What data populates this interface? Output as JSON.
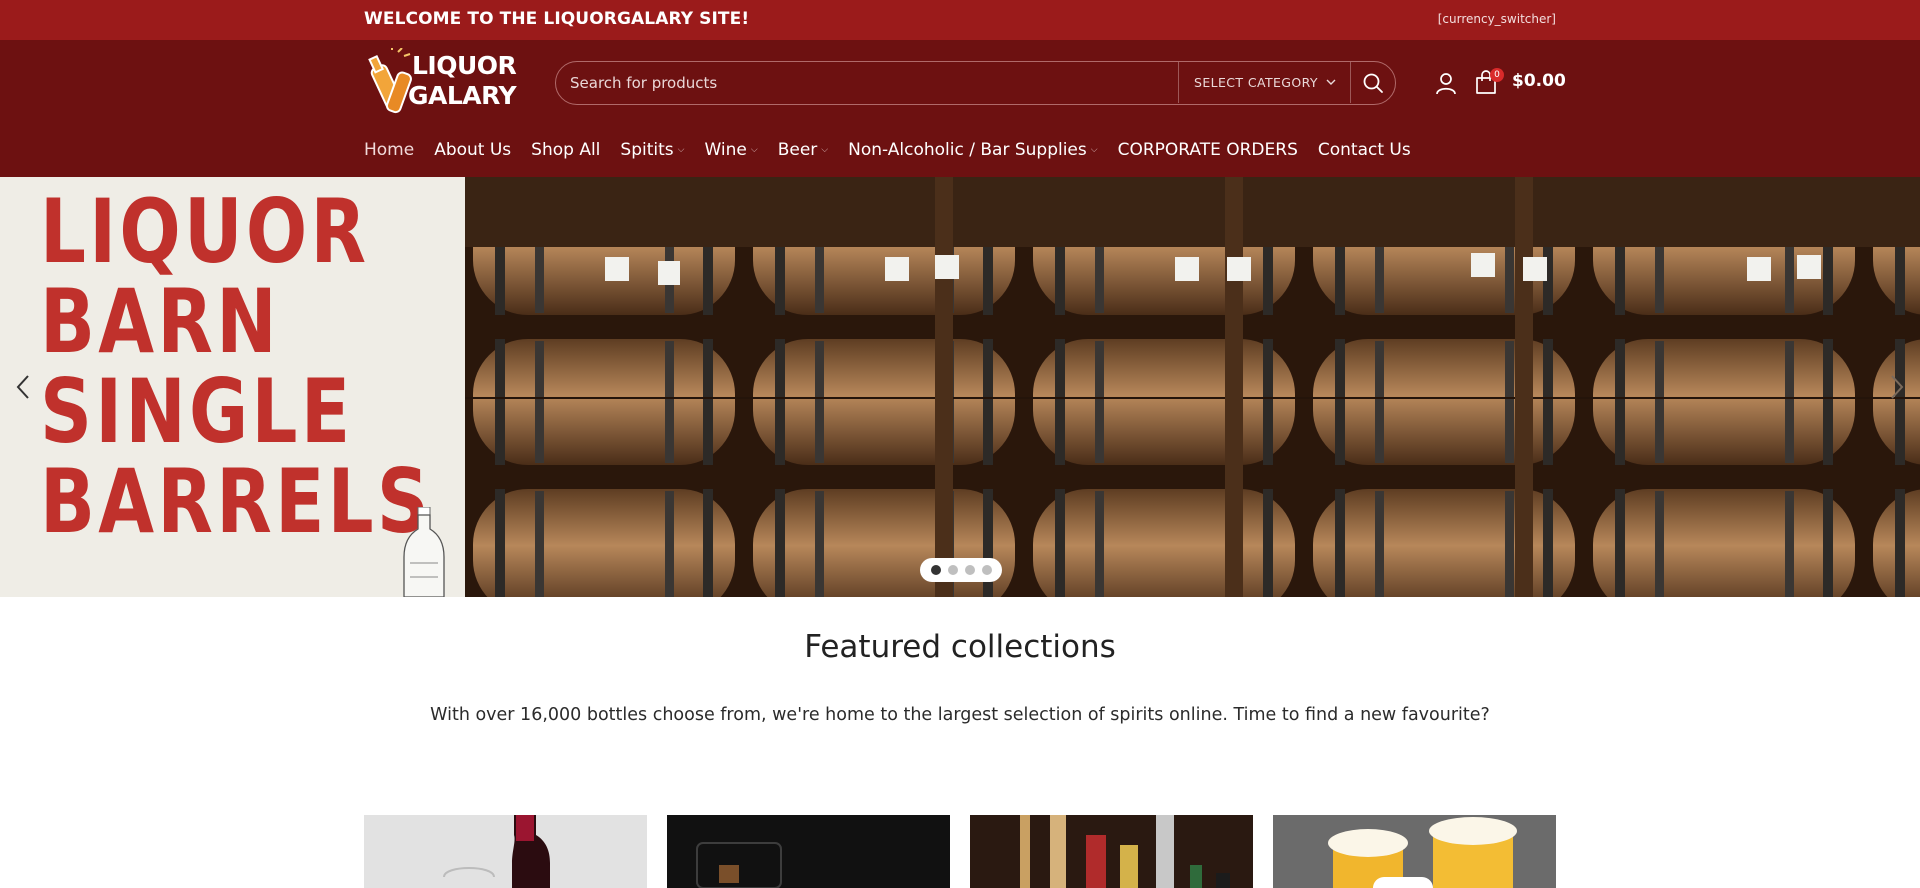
{
  "topbar": {
    "welcome": "WELCOME TO THE LIQUORGALARY SITE!",
    "currency_switcher": "[currency_switcher]"
  },
  "logo": {
    "line1": "LIQUOR",
    "line2": "GALARY"
  },
  "search": {
    "placeholder": "Search for products",
    "category_label": "SELECT CATEGORY"
  },
  "cart": {
    "count": "0",
    "total": "$0.00"
  },
  "nav": {
    "items": [
      {
        "label": "Home"
      },
      {
        "label": "About Us"
      },
      {
        "label": "Shop All"
      },
      {
        "label": "Spitits"
      },
      {
        "label": "Wine"
      },
      {
        "label": "Beer"
      },
      {
        "label": "Non-Alcoholic / Bar Supplies"
      },
      {
        "label": "CORPORATE ORDERS"
      },
      {
        "label": "Contact Us"
      }
    ]
  },
  "hero": {
    "line1": "LIQUOR",
    "line2": "BARN",
    "line3": "SINGLE",
    "line4": "BARRELS",
    "slide_count": 4,
    "active_slide": 1
  },
  "featured": {
    "title": "Featured collections",
    "subtitle": "With over 16,000 bottles choose from, we're home to the largest selection of spirits online. Time to find a new favourite?"
  },
  "colors": {
    "topbar": "#9b1b1b",
    "header": "#6d1111",
    "hero_text": "#c0312c"
  }
}
